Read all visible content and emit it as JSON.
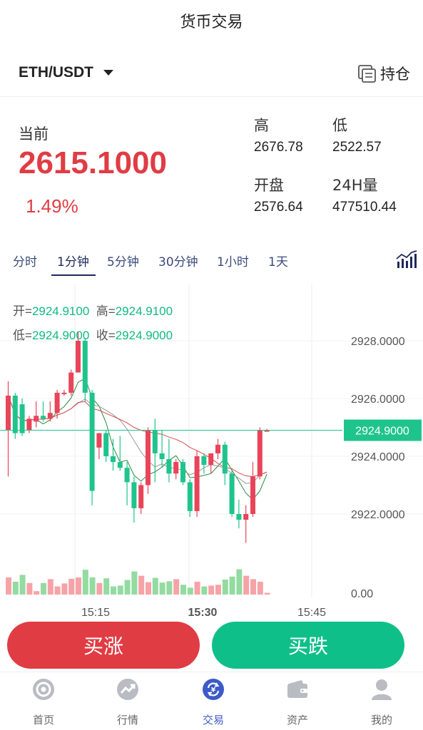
{
  "header": {
    "title": "货币交易"
  },
  "pair": {
    "name": "ETH/USDT",
    "hold_label": "持仓"
  },
  "ticker": {
    "current_label": "当前",
    "price": "2615.1000",
    "change": "1.49%",
    "high_label": "高",
    "high": "2676.78",
    "low_label": "低",
    "low": "2522.57",
    "open_label": "开盘",
    "open": "2576.64",
    "volume_label": "24H量",
    "volume": "477510.44"
  },
  "intervals": [
    "分时",
    "1分钟",
    "5分钟",
    "30分钟",
    "1小时",
    "1天"
  ],
  "active_interval": "1分钟",
  "ohlc": {
    "open_label": "开=",
    "open": "2924.9100",
    "high_label": "高=",
    "high": "2924.9100",
    "low_label": "低=",
    "low": "2924.9000",
    "close_label": "收=",
    "close": "2924.9000"
  },
  "chart_data": {
    "type": "candlestick",
    "y_ticks": [
      "2928.0000",
      "2926.0000",
      "2924.0000",
      "2922.0000"
    ],
    "y_tick_values": [
      2928,
      2926,
      2924,
      2922
    ],
    "volume_axis_label": "0.00",
    "x_ticks": [
      "15:15",
      "15:30",
      "15:45"
    ],
    "last_price": "2924.9000",
    "last_price_value": 2924.9,
    "colors": {
      "up": "#e8455a",
      "down": "#1fc48d",
      "up_vol": "#f6a3a8",
      "down_vol": "#93dba0"
    },
    "candles": [
      {
        "o": 2924.9,
        "h": 2926.6,
        "l": 2923.3,
        "c": 2926.1
      },
      {
        "o": 2926.1,
        "h": 2926.2,
        "l": 2924.6,
        "c": 2924.8
      },
      {
        "o": 2925.8,
        "h": 2926.0,
        "l": 2924.7,
        "c": 2924.8
      },
      {
        "o": 2924.9,
        "h": 2925.4,
        "l": 2924.8,
        "c": 2925.3
      },
      {
        "o": 2925.2,
        "h": 2925.9,
        "l": 2925.0,
        "c": 2925.4
      },
      {
        "o": 2925.4,
        "h": 2925.9,
        "l": 2925.2,
        "c": 2925.3
      },
      {
        "o": 2925.3,
        "h": 2925.9,
        "l": 2925.2,
        "c": 2925.5
      },
      {
        "o": 2925.5,
        "h": 2926.3,
        "l": 2925.3,
        "c": 2926.2
      },
      {
        "o": 2926.2,
        "h": 2926.3,
        "l": 2926.1,
        "c": 2926.2
      },
      {
        "o": 2926.2,
        "h": 2927.0,
        "l": 2926.1,
        "c": 2926.9
      },
      {
        "o": 2926.9,
        "h": 2928.3,
        "l": 2926.9,
        "c": 2928.0
      },
      {
        "o": 2928.0,
        "h": 2928.1,
        "l": 2925.9,
        "c": 2926.2
      },
      {
        "o": 2926.2,
        "h": 2926.3,
        "l": 2922.3,
        "c": 2922.8
      },
      {
        "o": 2924.3,
        "h": 2924.8,
        "l": 2923.9,
        "c": 2924.8
      },
      {
        "o": 2924.8,
        "h": 2924.9,
        "l": 2923.8,
        "c": 2924.0
      },
      {
        "o": 2924.0,
        "h": 2924.6,
        "l": 2923.5,
        "c": 2923.8
      },
      {
        "o": 2923.8,
        "h": 2924.7,
        "l": 2923.5,
        "c": 2923.6
      },
      {
        "o": 2923.6,
        "h": 2923.8,
        "l": 2922.3,
        "c": 2923.1
      },
      {
        "o": 2923.1,
        "h": 2923.3,
        "l": 2921.7,
        "c": 2922.2
      },
      {
        "o": 2922.2,
        "h": 2923.1,
        "l": 2922.0,
        "c": 2923.0
      },
      {
        "o": 2923.0,
        "h": 2925.0,
        "l": 2922.7,
        "c": 2924.9
      },
      {
        "o": 2924.9,
        "h": 2925.3,
        "l": 2923.1,
        "c": 2924.1
      },
      {
        "o": 2924.1,
        "h": 2924.9,
        "l": 2923.6,
        "c": 2923.9
      },
      {
        "o": 2923.9,
        "h": 2924.6,
        "l": 2923.1,
        "c": 2923.4
      },
      {
        "o": 2923.4,
        "h": 2923.9,
        "l": 2923.2,
        "c": 2923.8
      },
      {
        "o": 2923.8,
        "h": 2923.9,
        "l": 2923.0,
        "c": 2923.1
      },
      {
        "o": 2923.1,
        "h": 2923.2,
        "l": 2921.9,
        "c": 2922.1
      },
      {
        "o": 2922.1,
        "h": 2924.2,
        "l": 2921.9,
        "c": 2924.0
      },
      {
        "o": 2924.0,
        "h": 2924.1,
        "l": 2923.4,
        "c": 2923.7
      },
      {
        "o": 2923.7,
        "h": 2924.1,
        "l": 2923.4,
        "c": 2924.1
      },
      {
        "o": 2924.1,
        "h": 2924.6,
        "l": 2923.9,
        "c": 2924.4
      },
      {
        "o": 2924.4,
        "h": 2924.5,
        "l": 2923.0,
        "c": 2923.4
      },
      {
        "o": 2923.4,
        "h": 2923.5,
        "l": 2921.9,
        "c": 2922.0
      },
      {
        "o": 2922.0,
        "h": 2922.5,
        "l": 2921.5,
        "c": 2921.8
      },
      {
        "o": 2921.8,
        "h": 2922.3,
        "l": 2921.0,
        "c": 2922.0
      },
      {
        "o": 2922.0,
        "h": 2923.8,
        "l": 2921.9,
        "c": 2923.3
      },
      {
        "o": 2923.3,
        "h": 2925.0,
        "l": 2923.2,
        "c": 2924.9
      },
      {
        "o": 2924.9,
        "h": 2924.95,
        "l": 2924.85,
        "c": 2924.9
      }
    ],
    "volumes": [
      0.4,
      0.3,
      0.46,
      0.27,
      0.08,
      0.27,
      0.36,
      0.19,
      0.26,
      0.37,
      0.4,
      0.58,
      0.4,
      0.27,
      0.38,
      0.19,
      0.21,
      0.34,
      0.54,
      0.44,
      0.29,
      0.39,
      0.28,
      0.31,
      0.36,
      0.23,
      0.16,
      0.3,
      0.19,
      0.21,
      0.23,
      0.35,
      0.42,
      0.59,
      0.44,
      0.36,
      0.3,
      0.04
    ]
  },
  "nav": [
    {
      "label": "首页",
      "icon": "home-icon"
    },
    {
      "label": "行情",
      "icon": "market-icon"
    },
    {
      "label": "交易",
      "icon": "trade-icon"
    },
    {
      "label": "资产",
      "icon": "wallet-icon"
    },
    {
      "label": "我的",
      "icon": "user-icon"
    }
  ],
  "buttons": {
    "buy": "买涨",
    "sell": "买跌"
  }
}
